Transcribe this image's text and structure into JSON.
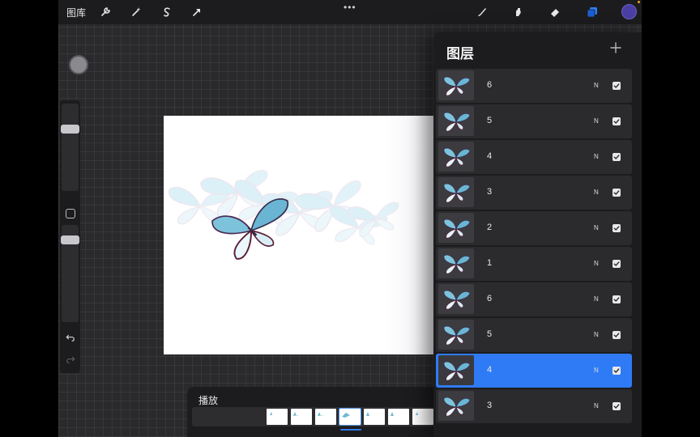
{
  "toolbar": {
    "gallery_label": "图库",
    "menu_dots": "•••",
    "icons": [
      "wrench-icon",
      "magic-wand-icon",
      "selection-icon",
      "transform-arrow-icon",
      "brush-icon",
      "smudge-icon",
      "eraser-icon",
      "layers-icon",
      "color-icon"
    ],
    "current_color": "#4b3fa3"
  },
  "layers_panel": {
    "title": "图层",
    "add_icon": "plus-icon",
    "layers": [
      {
        "name": "6",
        "blend": "N",
        "visible": true,
        "selected": false
      },
      {
        "name": "5",
        "blend": "N",
        "visible": true,
        "selected": false
      },
      {
        "name": "4",
        "blend": "N",
        "visible": true,
        "selected": false
      },
      {
        "name": "3",
        "blend": "N",
        "visible": true,
        "selected": false
      },
      {
        "name": "2",
        "blend": "N",
        "visible": true,
        "selected": false
      },
      {
        "name": "1",
        "blend": "N",
        "visible": true,
        "selected": false
      },
      {
        "name": "6",
        "blend": "N",
        "visible": true,
        "selected": false
      },
      {
        "name": "5",
        "blend": "N",
        "visible": true,
        "selected": false
      },
      {
        "name": "4",
        "blend": "N",
        "visible": true,
        "selected": true
      },
      {
        "name": "3",
        "blend": "N",
        "visible": true,
        "selected": false
      }
    ]
  },
  "playback": {
    "title": "播放",
    "frame_count": 7,
    "current_frame": 4
  },
  "colors": {
    "accent": "#2f7bf5",
    "panel": "#1c1c1e",
    "butterfly_blue": "#7fc4dd"
  }
}
